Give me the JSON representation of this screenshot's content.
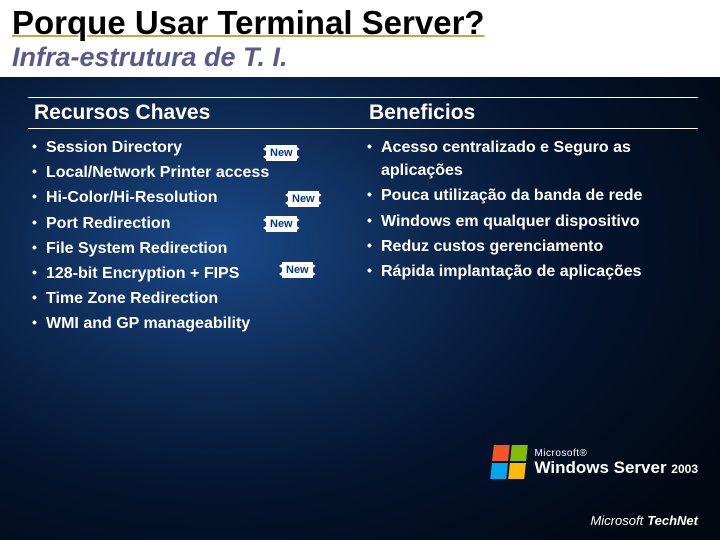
{
  "header": {
    "title": "Porque Usar Terminal Server?",
    "subtitle": "Infra-estrutura de T. I."
  },
  "left": {
    "heading": "Recursos Chaves",
    "items": [
      "Session Directory",
      "Local/Network Printer access",
      "Hi-Color/Hi-Resolution",
      "Port Redirection",
      "File System Redirection",
      "128-bit Encryption + FIPS",
      "Time Zone Redirection",
      "WMI and GP manageability"
    ]
  },
  "right": {
    "heading": "Beneficios",
    "items": [
      "Acesso centralizado e Seguro as aplicações",
      "Pouca utilização da banda de rede",
      "Windows em qualquer dispositivo",
      "Reduz custos gerenciamento",
      "Rápida implantação de aplicações"
    ]
  },
  "badges": {
    "b1": "New",
    "b2": "New",
    "b3": "New",
    "b4": "New"
  },
  "footer": {
    "ms": "Microsoft®",
    "product": "Windows Server",
    "year": "2003",
    "brand_ms": "Microsoft",
    "brand_tn": "TechNet"
  }
}
